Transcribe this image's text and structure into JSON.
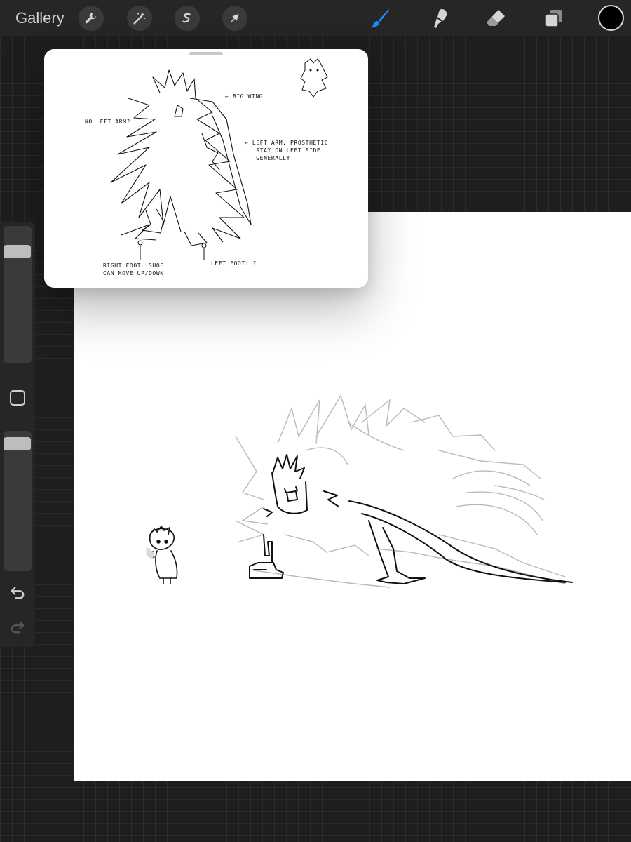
{
  "toolbar": {
    "gallery_label": "Gallery",
    "left_tools": [
      "wrench-icon",
      "magic-wand-icon",
      "selection-icon",
      "transform-arrow-icon"
    ],
    "right_tools": [
      "brush-icon",
      "smudge-icon",
      "eraser-icon",
      "layers-icon"
    ],
    "active_tool": "brush",
    "accent_color": "#1a8cff",
    "current_color": "#000000"
  },
  "reference": {
    "notes": {
      "big_wing": "← BIG WING",
      "no_left_arm": "NO LEFT ARM?",
      "left_arm_prosthetic": "← LEFT ARM: PROSTHETIC\n   STAY ON LEFT SIDE\n   GENERALLY",
      "right_foot": "RIGHT FOOT: SHOE\nCAN MOVE UP/DOWN",
      "left_foot": "LEFT FOOT: ?"
    }
  },
  "sidebar": {
    "brush_size_level": 0.85,
    "opacity_level": 0.95
  }
}
